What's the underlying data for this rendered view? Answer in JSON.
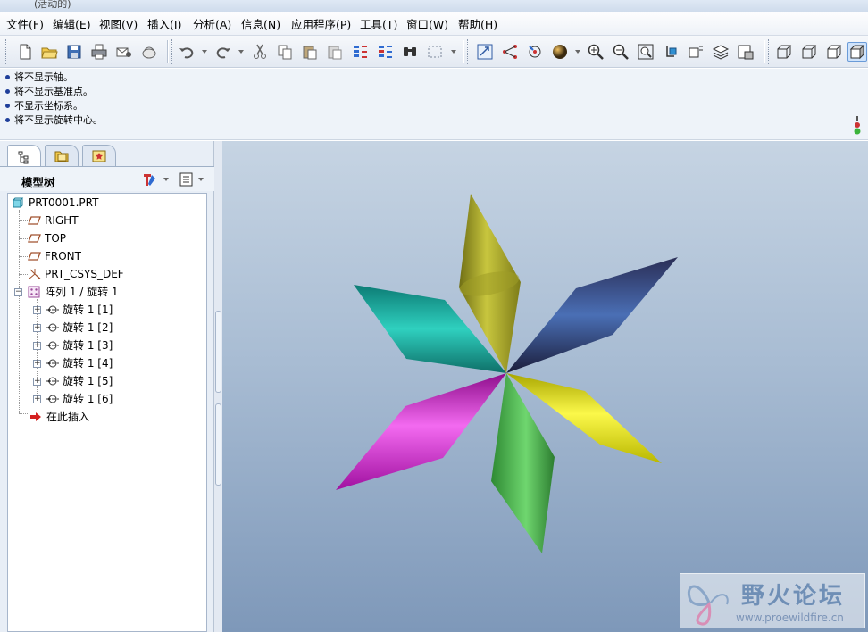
{
  "window": {
    "title_fragment": "(活动的)"
  },
  "menu": [
    {
      "label": "文件(F)"
    },
    {
      "label": "编辑(E)"
    },
    {
      "label": "视图(V)"
    },
    {
      "label": "插入(I)"
    },
    {
      "label": "分析(A)"
    },
    {
      "label": "信息(N)"
    },
    {
      "label": "应用程序(P)"
    },
    {
      "label": "工具(T)"
    },
    {
      "label": "窗口(W)"
    },
    {
      "label": "帮助(H)"
    }
  ],
  "toolbar": {
    "icons": [
      "new-file-icon",
      "open-folder-icon",
      "save-icon",
      "print-icon",
      "send-mail-icon",
      "mail-icon",
      "undo-icon",
      "redo-icon",
      "cut-icon",
      "copy-icon",
      "paste-icon",
      "paste-special-icon",
      "regenerate-icon",
      "regen-manager-icon",
      "find-icon",
      "select-box-icon",
      "refit-icon",
      "datum-display-icon",
      "spin-center-icon",
      "shading-sphere-icon",
      "zoom-in-icon",
      "zoom-out-icon",
      "refit-view-icon",
      "reorient-icon",
      "saved-views-icon",
      "layers-icon",
      "view-manager-icon",
      "wireframe-icon",
      "hidden-line-icon",
      "no-hidden-icon",
      "shading-icon"
    ]
  },
  "messages": [
    "将不显示轴。",
    "将不显示基准点。",
    "不显示坐标系。",
    "将不显示旋转中心。"
  ],
  "model_tree": {
    "header": "模型树",
    "root": "PRT0001.PRT",
    "datums": [
      "RIGHT",
      "TOP",
      "FRONT"
    ],
    "csys": "PRT_CSYS_DEF",
    "pattern": "阵列 1 / 旋转 1",
    "pattern_items": [
      "旋转 1 [1]",
      "旋转 1 [2]",
      "旋转 1 [3]",
      "旋转 1 [4]",
      "旋转 1 [5]",
      "旋转 1 [6]"
    ],
    "insert_here": "在此插入"
  },
  "colors": {
    "blade_olive": "#a9a82a",
    "blade_navy": "#3b3f6e",
    "blade_teal": "#1fa89a",
    "blade_yellow": "#e3e10c",
    "blade_green": "#4cb84e",
    "blade_magenta": "#d41ed2"
  },
  "watermark": {
    "title": "野火论坛",
    "url": "www.proewildfire.cn"
  }
}
